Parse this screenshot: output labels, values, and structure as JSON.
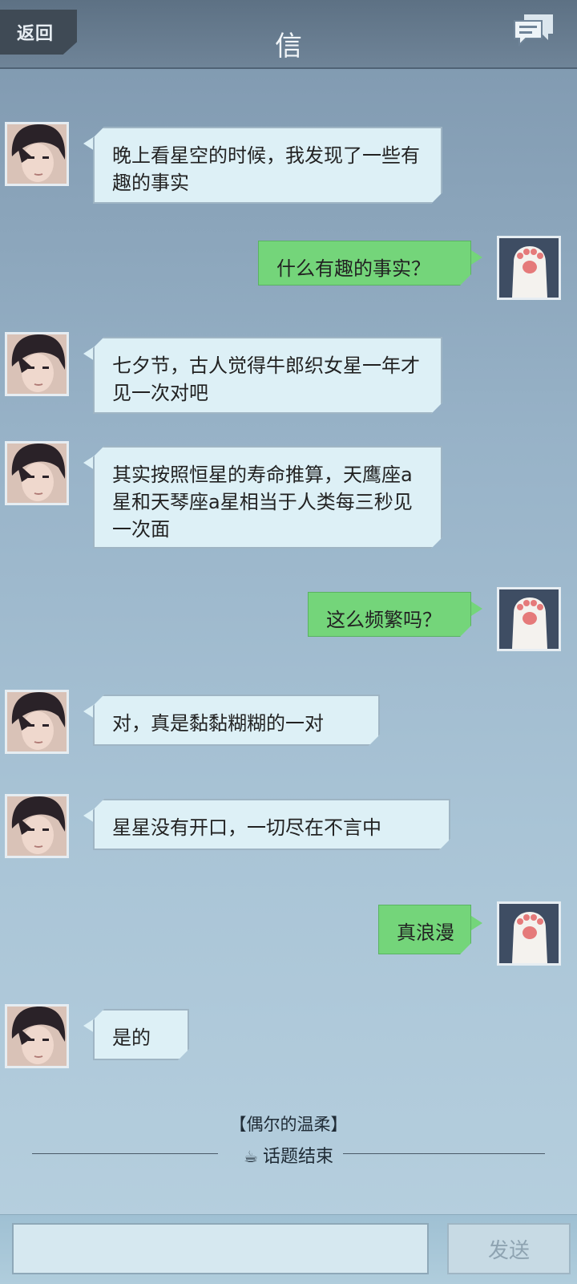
{
  "header": {
    "back_label": "返回",
    "title": "信",
    "message_list_icon": "chat-bubbles-icon"
  },
  "messages": [
    {
      "sender": "other",
      "text": "晚上看星空的时候，我发现了一些有趣的事实"
    },
    {
      "sender": "self",
      "text": "什么有趣的事实？"
    },
    {
      "sender": "other",
      "text": "七夕节，古人觉得牛郎织女星一年才见一次对吧"
    },
    {
      "sender": "other",
      "text": "其实按照恒星的寿命推算，天鹰座a星和天琴座a星相当于人类每三秒见一次面"
    },
    {
      "sender": "self",
      "text": "这么频繁吗？"
    },
    {
      "sender": "other",
      "text": "对，真是黏黏糊糊的一对"
    },
    {
      "sender": "other",
      "text": "星星没有开口，一切尽在不言中"
    },
    {
      "sender": "self",
      "text": "真浪漫"
    },
    {
      "sender": "other",
      "text": "是的"
    }
  ],
  "topic": {
    "name": "【偶尔的温柔】",
    "end_label": "话题结束",
    "end_icon": "coffee-cup-icon"
  },
  "composer": {
    "placeholder": "",
    "send_label": "发送"
  },
  "colors": {
    "self_bubble": "#74d57a",
    "other_bubble": "#ddf0f6",
    "header": "#6f8498"
  }
}
